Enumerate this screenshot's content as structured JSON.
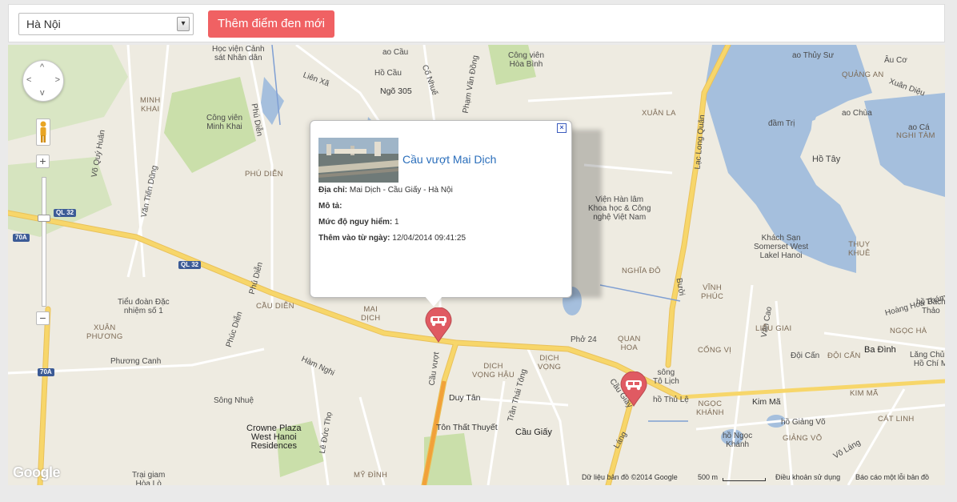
{
  "city_select": {
    "value": "Hà Nội",
    "arrow": "▾"
  },
  "add_button": "Thêm điểm đen mới",
  "map": {
    "labels": {
      "hoc_vien": "Học viện Cảnh\nsát Nhân dân",
      "minh_khai": "MINH\nKHAI",
      "cong_vien_minh_khai": "Công viên\nMinh Khai",
      "vo_quy_huan": "Võ Quý Huân",
      "van_tien_dung": "Văn Tiến Dũng",
      "phu_dien_top": "Phú Diễn",
      "phu_dien_dist": "PHÚ DIỄN",
      "phu_dien_mid": "Phú Diễn",
      "lien_xa": "Liên Xã",
      "ngo_305": "Ngõ 305",
      "ho_cau": "Hồ Cầu",
      "ao_cau": "ao Cầu",
      "co_nhue": "Cổ Nhuế",
      "pham_van_dong": "Phạm Văn Đồng",
      "cong_vien_hoa_binh": "Công viên\nHòa Bình",
      "xuan_la": "XUÂN LA",
      "lac_long_quan": "Lạc Long Quân",
      "ao_thuy_su": "ao Thủy Sư",
      "au_co": "Âu Cơ",
      "quang_an": "QUẢNG AN",
      "xuan_dieu": "Xuân Diệu",
      "dam_tri": "đầm Trị",
      "ao_chua": "ao Chùa",
      "ao_ca": "ao Cá",
      "nghi_tam": "NGHI TÀM",
      "ho_tay": "Hồ Tây",
      "vien_han_lam": "Viện Hàn lâm\nKhoa học & Công\nnghệ Việt Nam",
      "khach_san": "Khách Sạn\nSomerset West\nLakel Hanoi",
      "thuy_khue": "THỤY\nKHUÊ",
      "nghia_do": "NGHĨA ĐÔ",
      "buoi": "Bưởi",
      "vinh_phuc": "VĨNH\nPHÚC",
      "van_cao": "Văn Cao",
      "hoang_hoa_tham": "Hoàng Hoa Thám",
      "ho_bach_thao": "hồ Bách\nThảo",
      "ngoc_ha": "NGỌC HÀ",
      "lieu_giai": "LIỄU GIAI",
      "ba_dinh": "Ba Đình",
      "doi_can_1": "Đội Cấn",
      "doi_can_2": "ĐỘI CẤN",
      "cong_vi": "CỐNG VỊ",
      "lang_chu_tich": "Lăng Chủ Tị\nHồ Chí Mi",
      "quan_hoa": "QUAN\nHOA",
      "pho_24": "Phở 24",
      "tieu_doan": "Tiểu đoàn Đặc\nnhiệm số 1",
      "cau_dien": "CẦU DIỄN",
      "mai_dich": "MAI\nDỊCH",
      "phuc_dien": "Phúc Diễn",
      "xuan_phuong": "XUÂN\nPHƯƠNG",
      "phuong_canh": "Phương Canh",
      "ham_nghi": "Hàm Nghi",
      "cau_vuot": "Cầu vượt",
      "dich_vong_hau": "DỊCH\nVỌNG HẬU",
      "dich_vong": "DỊCH\nVỌNG",
      "tran_thai_tong": "Trần Thái Tông",
      "duy_tan": "Duy Tân",
      "ton_that_thuyet": "Tôn Thất Thuyết",
      "cau_giay": "Cầu Giấy",
      "cau_giay_road": "Cầu Giấy",
      "song_to_lich": "sông\nTô Lịch",
      "ho_thu_le": "hồ Thủ Lệ",
      "kim_ma": "Kim Mã",
      "kim_ma_dist": "KIM MÃ",
      "ngoc_khanh": "NGỌC\nKHÁNH",
      "ho_giang_vo": "hồ Giảng Võ",
      "giang_vo": "GIẢNG VÕ",
      "ho_ngoc_khanh": "hồ Ngọc\nKhánh",
      "cat_linh": "CÁT LINH",
      "lang": "Láng",
      "vo_lang": "Võ Láng",
      "song_nhue": "Sông Nhuệ",
      "le_duc_tho": "Lê Đức Thọ",
      "crowne": "Crowne Plaza\nWest Hanoi\nResidences",
      "trai_giam": "Trại giam\nHòa Lò",
      "my_dinh": "MỸ ĐÌNH",
      "ql32_1": "QL 32",
      "ql32_2": "QL 32",
      "r70a_1": "70A",
      "r70a_2": "70A"
    },
    "google_logo": "Google"
  },
  "popup": {
    "title": "Cầu vượt Mai Dịch",
    "address_label": "Địa chỉ:",
    "address_value": "Mai Dịch - Cầu Giấy - Hà Nội",
    "desc_label": "Mô tả:",
    "desc_value": "",
    "danger_label": "Mức độ nguy hiểm:",
    "danger_value": "1",
    "added_label": "Thêm vào từ ngày:",
    "added_value": "12/04/2014 09:41:25",
    "close": "×"
  },
  "footer": {
    "data_credit": "Dữ liệu bản đồ ©2014 Google",
    "scale": "500 m",
    "terms": "Điều khoản sử dụng",
    "report": "Báo cáo một lỗi bản đồ"
  },
  "icons": {
    "pan": "pan-control-icon",
    "pegman": "pegman-icon",
    "marker": "car-accident-marker-icon"
  },
  "colors": {
    "button": "#f06163",
    "marker": "#e05a62",
    "water": "#a5bfdd",
    "park": "#cadfaa",
    "road_major": "#f7d66a"
  }
}
